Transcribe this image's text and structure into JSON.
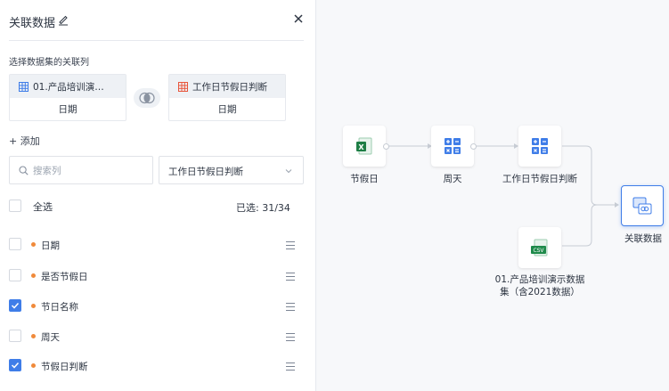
{
  "panel": {
    "title": "关联数据",
    "section_label": "选择数据集的关联列",
    "left_dataset": {
      "name": "01.产品培训演…",
      "field": "日期"
    },
    "right_dataset": {
      "name": "工作日节假日判断",
      "field": "日期"
    },
    "add_label": "+ 添加",
    "search_placeholder": "搜索列",
    "select_value": "工作日节假日判断",
    "select_all_label": "全选",
    "selected_count": "已选: 31/34",
    "columns": [
      {
        "label": "日期",
        "checked": false
      },
      {
        "label": "是否节假日",
        "checked": false
      },
      {
        "label": "节日名称",
        "checked": true
      },
      {
        "label": "周天",
        "checked": false
      },
      {
        "label": "节假日判断",
        "checked": true
      }
    ]
  },
  "canvas": {
    "nodes": [
      {
        "label": "节假日",
        "icon": "excel-icon"
      },
      {
        "label": "周天",
        "icon": "calculator-icon"
      },
      {
        "label": "工作日节假日判断",
        "icon": "calculator-icon"
      },
      {
        "label": "01.产品培训演示数据",
        "label2": "集（含2021数据）",
        "icon": "csv-icon"
      },
      {
        "label": "关联数据",
        "icon": "join-data-icon"
      }
    ]
  },
  "colors": {
    "accent": "#3f7de8",
    "dot": "#f08a3b",
    "excel_green": "#1e7e45",
    "csv_green": "#1e8a4a"
  }
}
